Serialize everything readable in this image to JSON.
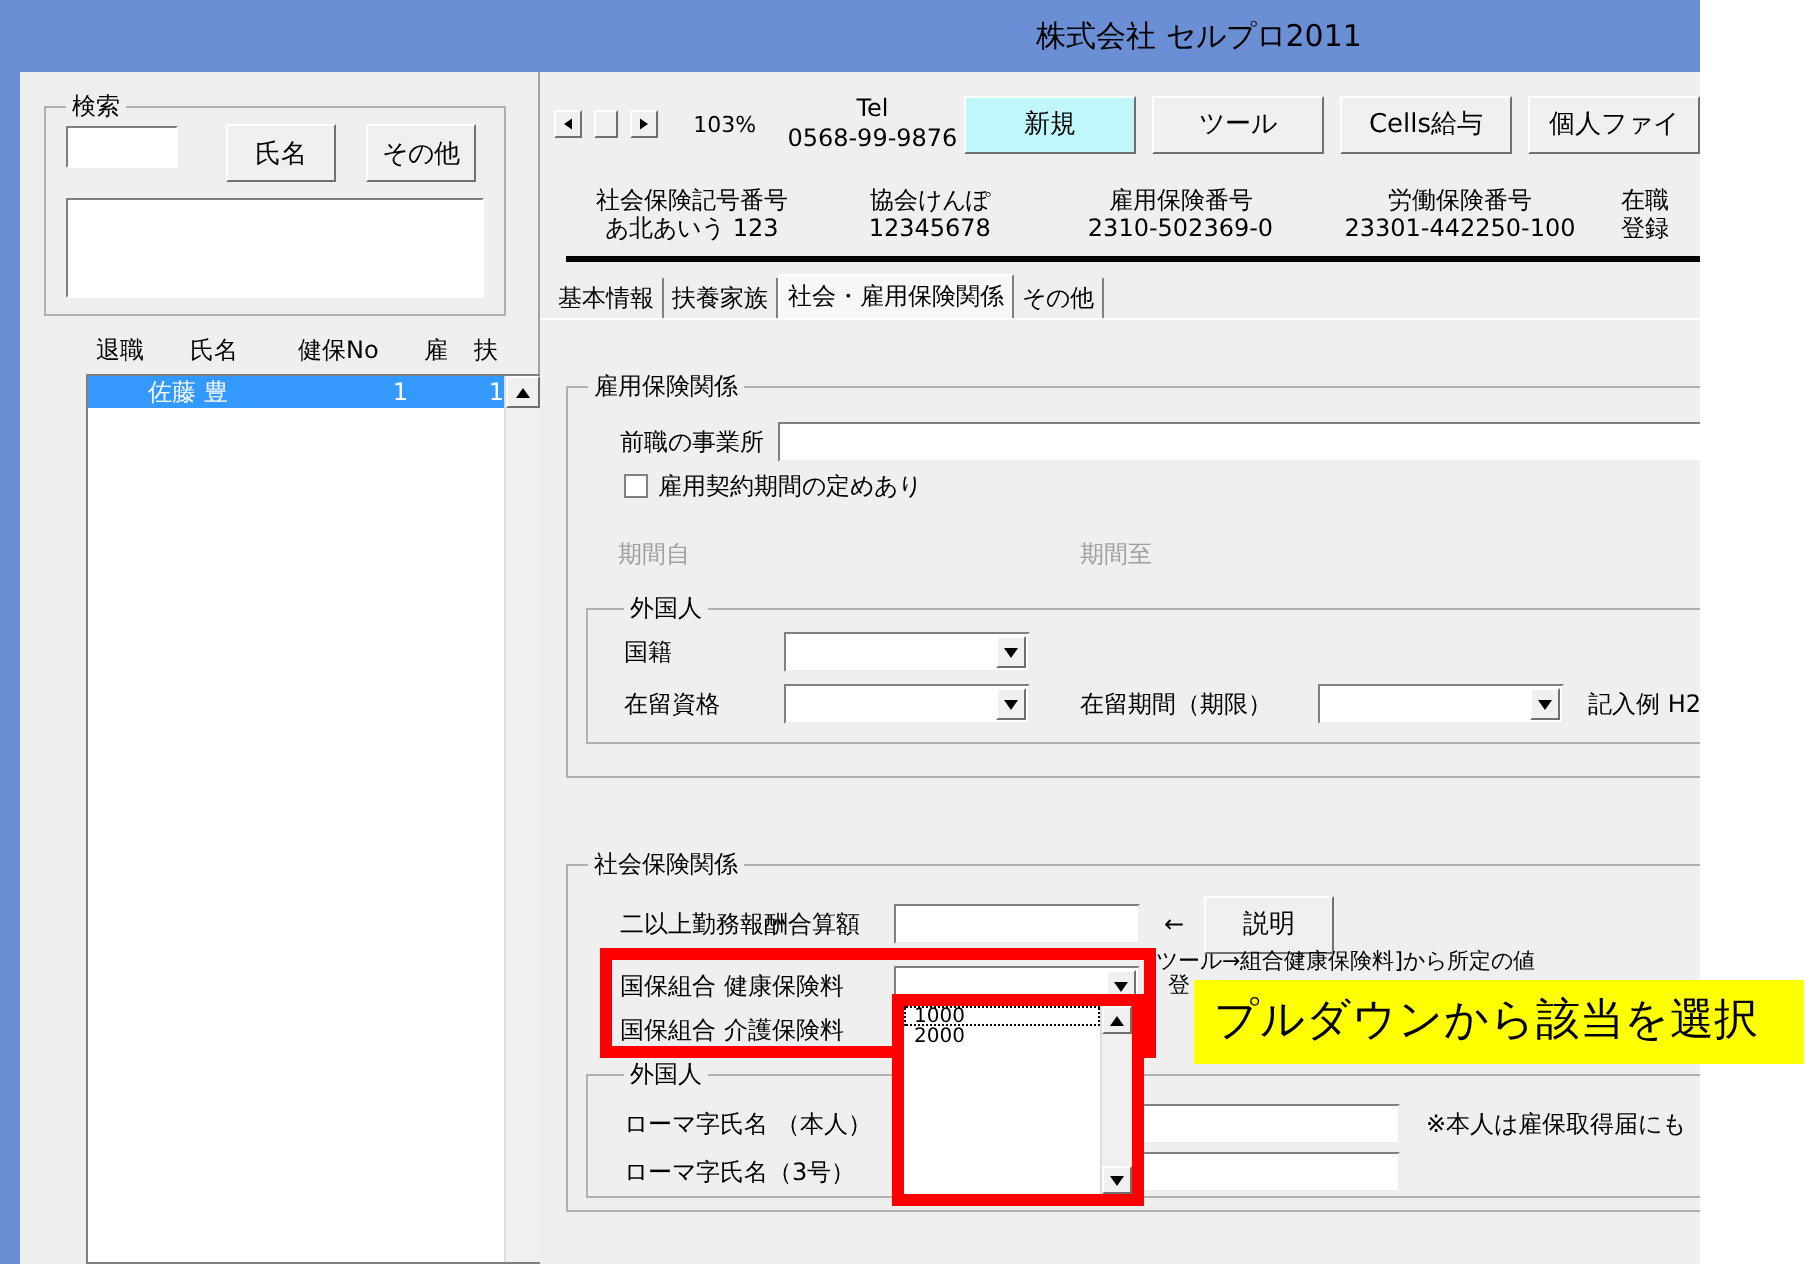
{
  "window": {
    "title": "株式会社  セルプロ2011"
  },
  "search": {
    "label": "検索",
    "buttons": [
      "氏名",
      "その他"
    ]
  },
  "employee_list": {
    "columns": [
      "退職",
      "氏名",
      "健保No",
      "雇",
      "扶"
    ],
    "rows": [
      {
        "cells": [
          "",
          "佐藤 豊",
          "1",
          "",
          "1"
        ],
        "selected": true
      }
    ]
  },
  "zoom": "103%",
  "tel": {
    "label": "Tel",
    "number": "0568-99-9876"
  },
  "toolbar": [
    {
      "label": "新規",
      "highlighted": true
    },
    {
      "label": "ツール",
      "highlighted": false
    },
    {
      "label": "Cells給与",
      "highlighted": false
    },
    {
      "label": "個人ファイ",
      "highlighted": false
    }
  ],
  "info": [
    {
      "label": "社会保険記号番号",
      "value": "あ北あいう 123"
    },
    {
      "label": "協会けんぽ",
      "value": "12345678"
    },
    {
      "label": "雇用保険番号",
      "value": "2310-502369-0"
    },
    {
      "label": "労働保険番号",
      "value": "23301-442250-100"
    },
    {
      "label": "在職",
      "value": "登録"
    }
  ],
  "tabs": [
    {
      "label": "基本情報",
      "selected": false
    },
    {
      "label": "扶養家族",
      "selected": false
    },
    {
      "label": "社会・雇用保険関係",
      "selected": true
    },
    {
      "label": "その他",
      "selected": false
    }
  ],
  "employment": {
    "title": "雇用保険関係",
    "previous_employer": "前職の事業所",
    "contract_checkbox": {
      "label": "雇用契約期間の定めあり",
      "checked": false
    },
    "period_from": {
      "label": "期間自",
      "disabled": true
    },
    "period_to": {
      "label": "期間至",
      "disabled": true
    },
    "foreigner": {
      "title": "外国人",
      "nationality": "国籍",
      "residence_status": "在留資格",
      "residence_period": "在留期間（期限）",
      "example": "記入例  H2"
    }
  },
  "social": {
    "title": "社会保険関係",
    "combined_pay": "二以上勤務報酬合算額",
    "arrow": "←",
    "explain_button": "説明",
    "health_fee": "国保組合  健康保険料",
    "care_fee": "国保組合  介護保険料",
    "note_lines": [
      "ツール→組合健康保険料]から所定の値",
      "登"
    ],
    "foreigner": {
      "title": "外国人",
      "roman_self": "ローマ字氏名  （本人）",
      "roman_spouse": "ローマ字氏名（3号）",
      "note": "※本人は雇保取得届にも"
    }
  },
  "dropdown": {
    "options": [
      "1000",
      "2000"
    ]
  },
  "callout": "プルダウンから該当を選択"
}
